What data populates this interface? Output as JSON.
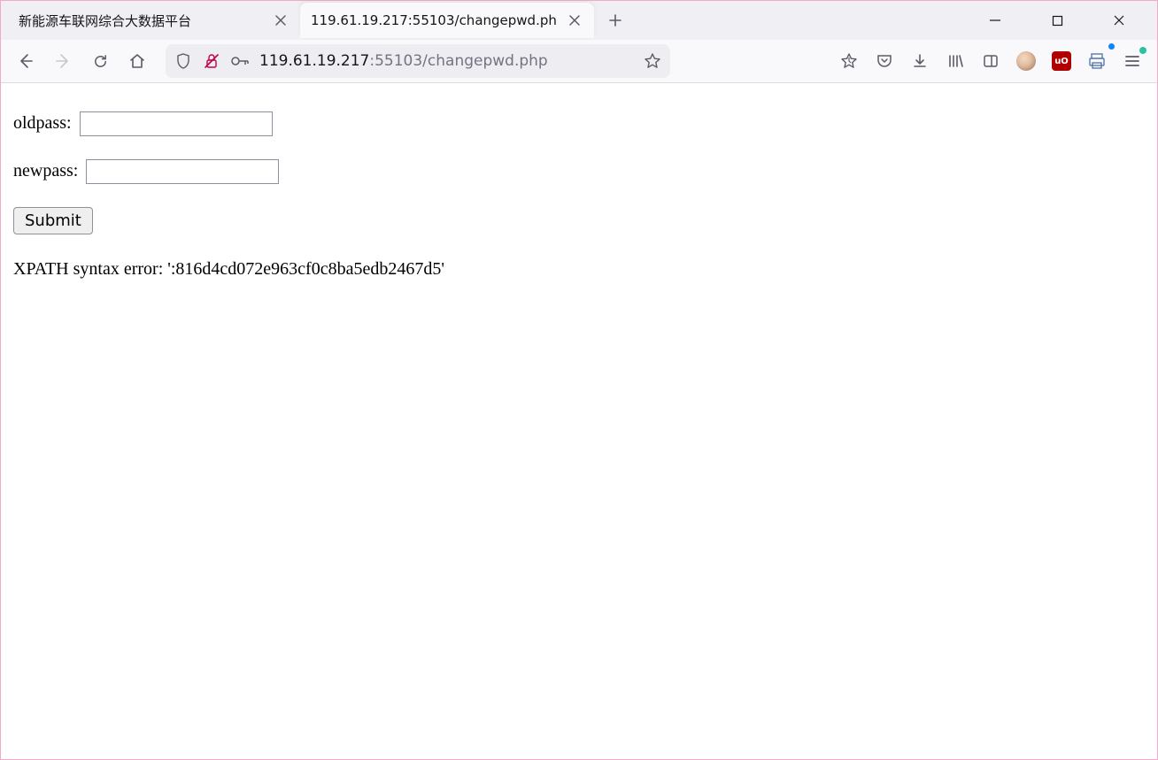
{
  "tabs": {
    "inactive": {
      "title": "新能源车联网综合大数据平台"
    },
    "active": {
      "title": "119.61.19.217:55103/changepwd.ph"
    }
  },
  "urlbar": {
    "host": "119.61.19.217",
    "rest": ":55103/changepwd.php"
  },
  "form": {
    "oldpass_label": "oldpass:",
    "newpass_label": "newpass:",
    "submit_label": "Submit",
    "oldpass_value": "",
    "newpass_value": ""
  },
  "error_message": "XPATH syntax error: ':816d4cd072e963cf0c8ba5edb2467d5'"
}
